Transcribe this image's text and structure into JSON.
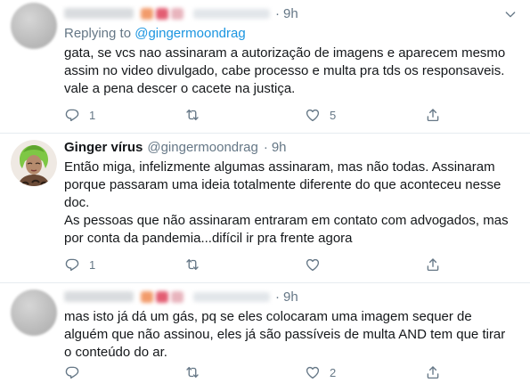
{
  "tweets": [
    {
      "time": "9h",
      "replying_prefix": "Replying to",
      "replying_handle": "@gingermoondrag",
      "lines": [
        "gata, se vcs nao assinaram a autorização de imagens e aparecem mesmo",
        "assim no video divulgado, cabe processo e multa pra tds os responsaveis.",
        "vale a pena descer o cacete na justiça."
      ],
      "reply_count": "1",
      "retweet_count": "",
      "like_count": "5"
    },
    {
      "name": "Ginger vírus",
      "handle": "@gingermoondrag",
      "time": "9h",
      "lines": [
        "Então miga, infelizmente algumas assinaram, mas não todas. Assinaram",
        "porque passaram uma ideia totalmente diferente do que aconteceu nesse",
        "doc.",
        "As pessoas que não assinaram entraram em contato com advogados, mas",
        "por conta da pandemia...difícil ir pra frente agora"
      ],
      "reply_count": "1",
      "retweet_count": "",
      "like_count": ""
    },
    {
      "time": "9h",
      "lines": [
        "mas isto já dá um gás, pq se eles colocaram uma imagem sequer de",
        "alguém que não assinou, eles já são passíveis de multa AND tem que tirar",
        "o conteúdo do ar."
      ],
      "reply_count": "",
      "retweet_count": "",
      "like_count": "2"
    }
  ],
  "icons": {
    "reply": "reply-icon",
    "retweet": "retweet-icon",
    "like": "heart-icon",
    "share": "share-icon",
    "more": "chevron-down-icon"
  },
  "colors": {
    "link": "#1b95e0",
    "muted": "#657786",
    "text": "#14171a"
  }
}
